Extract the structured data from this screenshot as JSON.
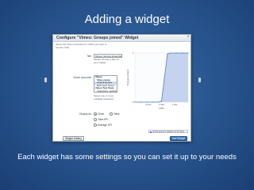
{
  "slide": {
    "title": "Adding a widget",
    "caption": "Each widget has some settings so you can set it up to your needs"
  },
  "dialog": {
    "title": "Configure \"Vimeo: Groups joined\" Widget",
    "close_glyph": "×",
    "intro_line1": "Select the Vimeo accounts for which you want to",
    "intro_line2": "see the chart",
    "title_label": "Title",
    "title_value": "Vimeo: Groups joined da",
    "title_hint_line1": "Please choose a title for",
    "title_hint_line2": "your widget",
    "accounts_label": "Vimeo Accounts",
    "accounts_items": [
      "Vimeo",
      "Vimeo demo",
      "vimeo2.de.test",
      "Borkmann Nexus",
      "Vimeo Test Team",
      "Categories: segfinfo"
    ],
    "accounts_hint_line1": "Select one or more",
    "accounts_hint_line2": "(multiple selection)",
    "display_label": "Display As",
    "display_options": [
      "Chart",
      "Table",
      "Total KPI",
      "Average KPI"
    ],
    "display_selected": "Chart",
    "gallery_button": "Widget Gallery",
    "add_button": "Add Widget"
  },
  "chart_data": {
    "type": "area",
    "title": "",
    "xlabel": "Date",
    "ylabel": "Groups Joined",
    "ylim": [
      0,
      1
    ],
    "yticks": [
      "0",
      "1"
    ],
    "xticks": [
      "1 Feb",
      "1 Mar",
      "1 Apr"
    ],
    "legend": "Vimeo Account Vartiven to the flow",
    "legend_position": "bottom-right",
    "series": [
      {
        "name": "",
        "color": "#4f7cc5",
        "x": [
          0,
          10,
          20,
          30,
          40,
          45,
          50,
          55,
          60,
          70,
          80,
          90
        ],
        "values": [
          0,
          0,
          0,
          0,
          0,
          0.02,
          0.5,
          0.98,
          1,
          1,
          1,
          1
        ]
      }
    ]
  },
  "colors": {
    "slide_bg": "#2a5791",
    "add_button": "#2f6cb0",
    "series": "#4f7cc5"
  }
}
